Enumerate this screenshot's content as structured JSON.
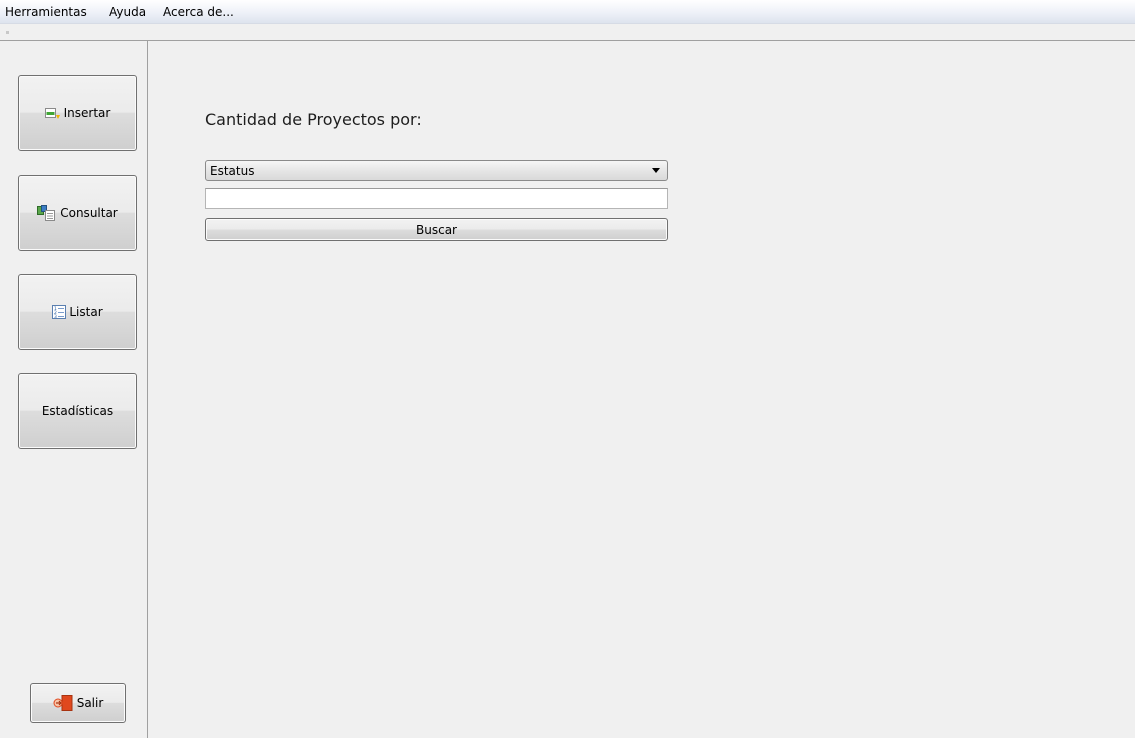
{
  "menu": {
    "items": [
      {
        "label": "Herramientas"
      },
      {
        "label": "Ayuda"
      },
      {
        "label": "Acerca de..."
      }
    ]
  },
  "sidebar": {
    "buttons": [
      {
        "label": "Insertar",
        "icon": "insert-icon"
      },
      {
        "label": "Consultar",
        "icon": "query-icon"
      },
      {
        "label": "Listar",
        "icon": "list-icon"
      },
      {
        "label": "Estadísticas",
        "icon": ""
      }
    ],
    "exit": {
      "label": "Salir",
      "icon": "exit-icon"
    }
  },
  "main": {
    "heading": "Cantidad de Proyectos por:",
    "filter_select": {
      "selected": "Estatus"
    },
    "search_input": {
      "value": "",
      "placeholder": ""
    },
    "search_button": "Buscar"
  },
  "colors": {
    "background": "#f0f0f0",
    "button_border": "#707070",
    "exit_icon": "#e0481e",
    "insert_icon": "#3fa535"
  }
}
